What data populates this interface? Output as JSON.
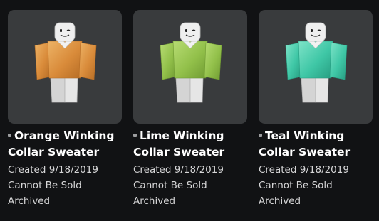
{
  "items": [
    {
      "title": "Orange Winking Collar Sweater",
      "created": "Created 9/18/2019",
      "sale_status": "Cannot Be Sold",
      "status": "Archived",
      "icon": "item-type-icon",
      "sweater_color": "#d98b3a",
      "sweater_highlight": "#edb366",
      "sweater_shadow": "#b56c25"
    },
    {
      "title": "Lime Winking Collar Sweater",
      "created": "Created 9/18/2019",
      "sale_status": "Cannot Be Sold",
      "status": "Archived",
      "icon": "item-type-icon",
      "sweater_color": "#92c04a",
      "sweater_highlight": "#b7dc73",
      "sweater_shadow": "#6f9a32"
    },
    {
      "title": "Teal Winking Collar Sweater",
      "created": "Created 9/18/2019",
      "sale_status": "Cannot Be Sold",
      "status": "Archived",
      "icon": "item-type-icon",
      "sweater_color": "#3fc7a6",
      "sweater_highlight": "#7ee3c8",
      "sweater_shadow": "#269c80"
    }
  ]
}
